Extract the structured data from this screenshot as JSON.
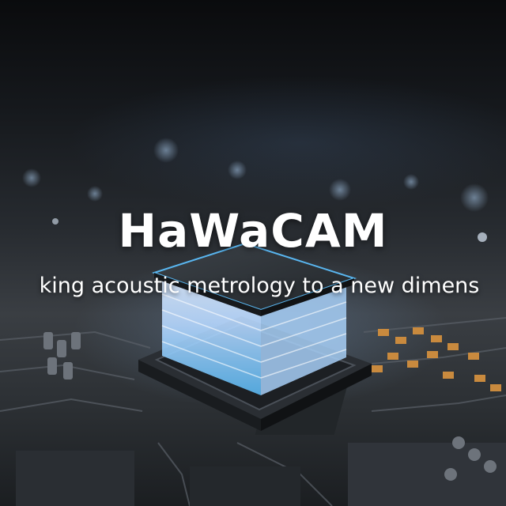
{
  "hero": {
    "title": "HaWaCAM",
    "subtitle": "king acoustic metrology to a new dimens"
  },
  "colors": {
    "text": "#ffffff",
    "chip_glow": "#9fd4ff",
    "component_orange": "#c98a3e",
    "background": "#0b0d10"
  }
}
